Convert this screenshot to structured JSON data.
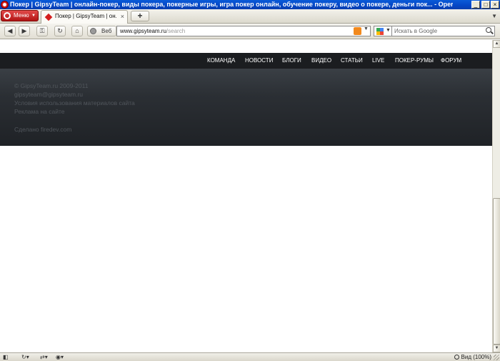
{
  "window": {
    "title": "Покер | GipsyTeam | онлайн-покер, виды покера, покерные игры, игра покер онлайн, обучение покеру, видео о покере, деньги пок... - Opera",
    "minimize": "_",
    "maximize": "□",
    "close": "×"
  },
  "tabbar": {
    "menu_label": "Меню",
    "active_tab": "Покер | GipsyTeam | он...",
    "new_tab": "+"
  },
  "navbar": {
    "web_button": "Веб",
    "address_domain": "www.gipsyteam.ru",
    "address_path": "/search",
    "search_placeholder": "Искать в Google"
  },
  "site": {
    "nav": [
      "КОМАНДА",
      "НОВОСТИ",
      "БЛОГИ",
      "ВИДЕО",
      "СТАТЬИ",
      "LIVE",
      "ПОКЕР-РУМЫ",
      "ФОРУМ"
    ],
    "footer": {
      "copyright": "© GipsyTeam.ru 2009-2011",
      "email": "gipsyteam@gipsyteam.ru",
      "terms": "Условия использования материалов сайта",
      "ads": "Реклама на сайте",
      "made_by": "Сделано firedev.com"
    }
  },
  "statusbar": {
    "zoom": "Вид (100%)"
  },
  "colors": {
    "site_nav_bg": "#1b1d20",
    "footer_bg": "#2b2f34",
    "footer_text": "#51565c",
    "titlebar": "#0346c6",
    "opera_red": "#b21414"
  },
  "icons": [
    "opera-logo-icon",
    "back-icon",
    "forward-icon",
    "key-icon",
    "reload-icon",
    "home-icon",
    "globe-icon",
    "rss-icon",
    "google-icon",
    "search-icon",
    "panel-toggle-icon",
    "turbo-icon",
    "sync-icon",
    "unite-icon",
    "zoom-icon"
  ]
}
